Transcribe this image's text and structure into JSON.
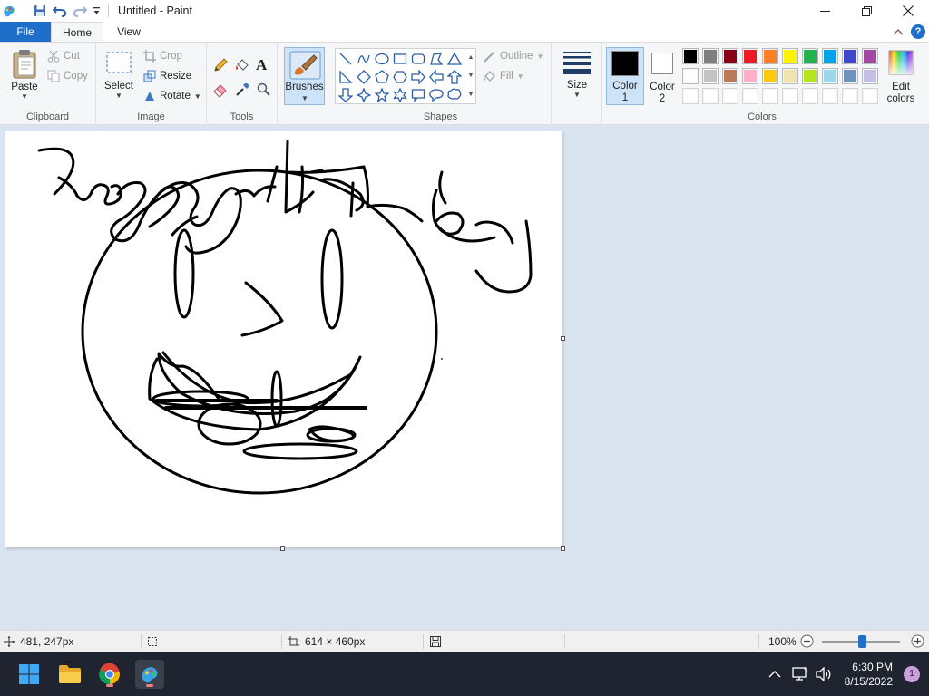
{
  "window": {
    "title": "Untitled - Paint"
  },
  "tabs": {
    "file": "File",
    "home": "Home",
    "view": "View",
    "help": "?"
  },
  "clipboard": {
    "label": "Clipboard",
    "paste": "Paste",
    "cut": "Cut",
    "copy": "Copy"
  },
  "image": {
    "label": "Image",
    "select": "Select",
    "crop": "Crop",
    "resize": "Resize",
    "rotate": "Rotate"
  },
  "tools": {
    "label": "Tools",
    "text_glyph": "A"
  },
  "brushes": {
    "label": "Brushes"
  },
  "shapes": {
    "label": "Shapes",
    "outline": "Outline",
    "fill": "Fill"
  },
  "size": {
    "label": "Size"
  },
  "colors": {
    "label": "Colors",
    "color1_line1": "Color",
    "color1_line2": "1",
    "color2_line1": "Color",
    "color2_line2": "2",
    "edit_line1": "Edit",
    "edit_line2": "colors",
    "color1_value": "#000000",
    "color2_value": "#ffffff",
    "palette_row1": [
      "#000000",
      "#7f7f7f",
      "#880015",
      "#ed1c24",
      "#ff7f27",
      "#fff200",
      "#22b14c",
      "#00a2e8",
      "#3f48cc",
      "#a349a4"
    ],
    "palette_row2": [
      "#ffffff",
      "#c3c3c3",
      "#b97a57",
      "#ffaec9",
      "#ffc90e",
      "#efe4b0",
      "#b5e61d",
      "#99d9ea",
      "#7092be",
      "#c8bfe7"
    ],
    "palette_row3": [
      "#ffffff",
      "#ffffff",
      "#ffffff",
      "#ffffff",
      "#ffffff",
      "#ffffff",
      "#ffffff",
      "#ffffff",
      "#ffffff",
      "#ffffff"
    ]
  },
  "status": {
    "cursor_pos": "481, 247px",
    "canvas_size": "614 × 460px",
    "zoom": "100%"
  },
  "taskbar": {
    "time": "6:30 PM",
    "date": "8/15/2022",
    "notifications": "1"
  }
}
